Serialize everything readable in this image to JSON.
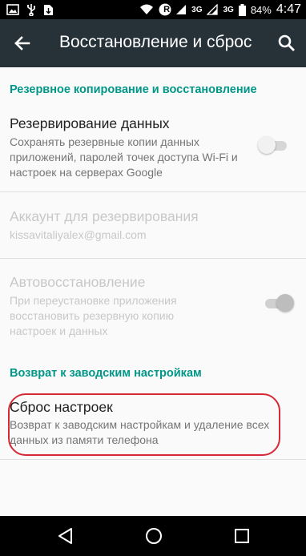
{
  "status_bar": {
    "network_label_1": "3G",
    "network_label_2": "3G",
    "roaming_label": "R",
    "battery": "84%",
    "time": "4:47"
  },
  "app_bar": {
    "title": "Восстановление и сброс",
    "back_icon": "arrow-left-icon",
    "search_icon": "search-icon"
  },
  "backup_section": {
    "header": "Резервное копирование и восстановление",
    "backup_data": {
      "title": "Резервирование данных",
      "summary": "Сохранять резервные копии данных приложений, паролей точек доступа Wi-Fi и настроек на серверах Google",
      "enabled": false
    },
    "backup_account": {
      "title": "Аккаунт для резервирования",
      "summary": "kissavitaliyalex@gmail.com"
    },
    "auto_restore": {
      "title": "Автовосстановление",
      "summary": "При переустановке приложения восстановить резервную копию настроек и данных",
      "enabled": true
    }
  },
  "reset_section": {
    "header": "Возврат к заводским настройкам",
    "factory_reset": {
      "title": "Сброс настроек",
      "summary": "Возврат к заводским настройкам и удаление всех данных из памяти телефона"
    }
  },
  "colors": {
    "app_bar": "#263238",
    "accent": "#009688",
    "highlight": "#d52a35"
  },
  "nav_bar": {
    "back_icon": "triangle-back-icon",
    "home_icon": "circle-home-icon",
    "recents_icon": "square-recents-icon"
  }
}
